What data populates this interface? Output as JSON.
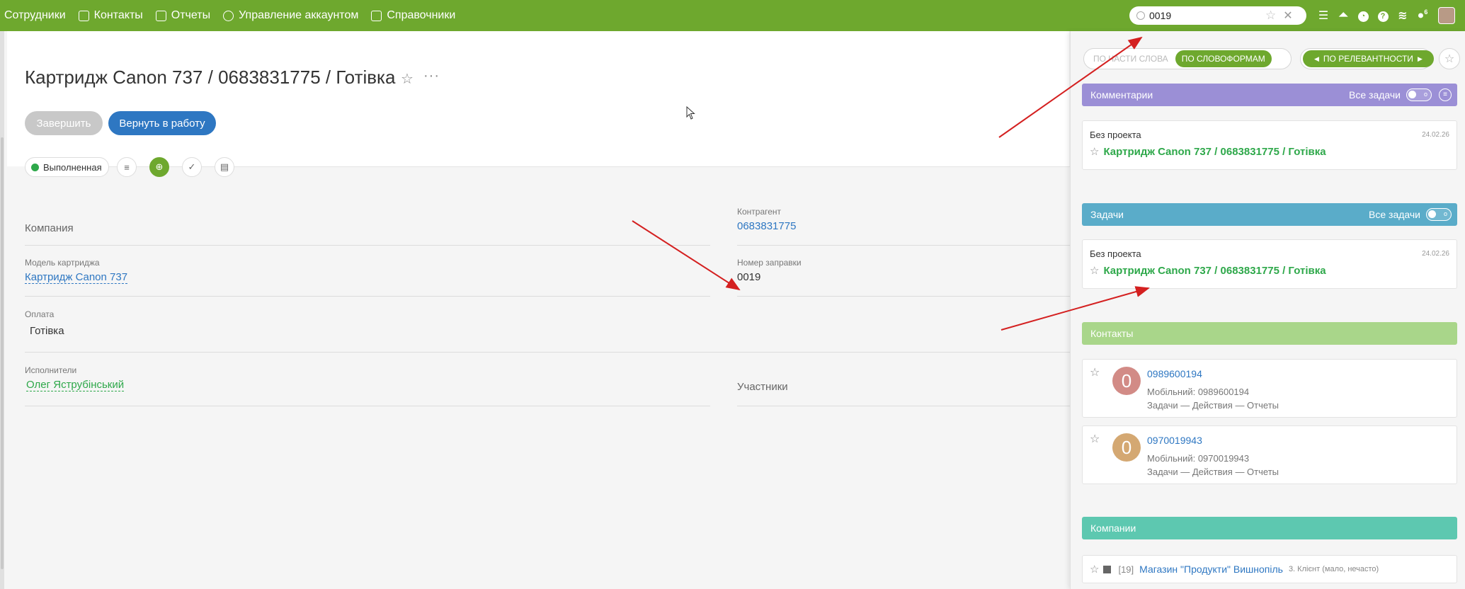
{
  "topnav": {
    "items": [
      {
        "label": "Сотрудники"
      },
      {
        "label": "Контакты"
      },
      {
        "label": "Отчеты"
      },
      {
        "label": "Управление аккаунтом"
      },
      {
        "label": "Справочники"
      }
    ]
  },
  "search": {
    "value": "0019"
  },
  "header_icons": {
    "notifications_badge": "6"
  },
  "task": {
    "title": "Картридж Canon 737 / 0683831775 / Готівка",
    "finish_label": "Завершить",
    "return_label": "Вернуть в работу",
    "status": "Выполненная"
  },
  "fields": {
    "company_placeholder": "Компания",
    "counterparty_label": "Контрагент",
    "counterparty_value": "0683831775",
    "model_label": "Модель картриджа",
    "model_value": "Картридж Canon 737",
    "refill_label": "Номер заправки",
    "refill_value": "0019",
    "payment_label": "Оплата",
    "payment_value": "Готівка",
    "executors_label": "Исполнители",
    "executors_value": "Олег Яструбінський",
    "participants_placeholder": "Участники"
  },
  "search_panel": {
    "mode_partial": "ПО ЧАСТИ СЛОВА",
    "mode_wordforms": "ПО СЛОВОФОРМАМ",
    "sort_label": "ПО РЕЛЕВАНТНОСТИ",
    "comments": {
      "title": "Комментарии",
      "all_tasks": "Все задачи",
      "project": "Без проекта",
      "date": "24.02.26",
      "link": "Картридж Canon 737 / 0683831775 / Готівка"
    },
    "tasks": {
      "title": "Задачи",
      "all_tasks": "Все задачи",
      "project": "Без проекта",
      "date": "24.02.26",
      "link": "Картридж Canon 737 / 0683831775 / Готівка"
    },
    "contacts": {
      "title": "Контакты",
      "items": [
        {
          "initial": "0",
          "name": "0989600194",
          "phone": "Мобільний: 0989600194",
          "links": "Задачи — Действия — Отчеты",
          "color": "#d28b86"
        },
        {
          "initial": "0",
          "name": "0970019943",
          "phone": "Мобільний: 0970019943",
          "links": "Задачи — Действия — Отчеты",
          "color": "#d4a872"
        }
      ]
    },
    "companies": {
      "title": "Компании",
      "item_num": "[19]",
      "item_name": "Магазин \"Продукти\" Вишнопіль",
      "item_type": "3. Клієнт (мало, нечасто)"
    }
  },
  "colors": {
    "topbar": "#6ea82e",
    "comments_header": "#9b8fd6",
    "tasks_header": "#5aacc9",
    "contacts_header": "#a9d68a",
    "companies_header": "#5dc8b0",
    "link_blue": "#2e77c2",
    "link_green": "#2ea84a",
    "annotation_arrow": "#d42020"
  }
}
